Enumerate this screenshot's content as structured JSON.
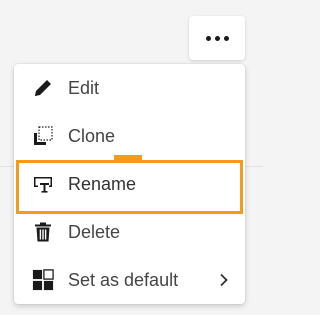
{
  "toolbar": {
    "more_icon": "more-horizontal-icon"
  },
  "menu": {
    "items": [
      {
        "label": "Edit",
        "icon": "pencil-icon"
      },
      {
        "label": "Clone",
        "icon": "clone-icon"
      },
      {
        "label": "Rename",
        "icon": "rename-icon"
      },
      {
        "label": "Delete",
        "icon": "trash-icon"
      },
      {
        "label": "Set as default",
        "icon": "grid-default-icon",
        "submenu_icon": "chevron-right-icon"
      }
    ]
  },
  "colors": {
    "focus": "#f39c1a",
    "text": "#444444",
    "background": "#f4f4f4"
  }
}
